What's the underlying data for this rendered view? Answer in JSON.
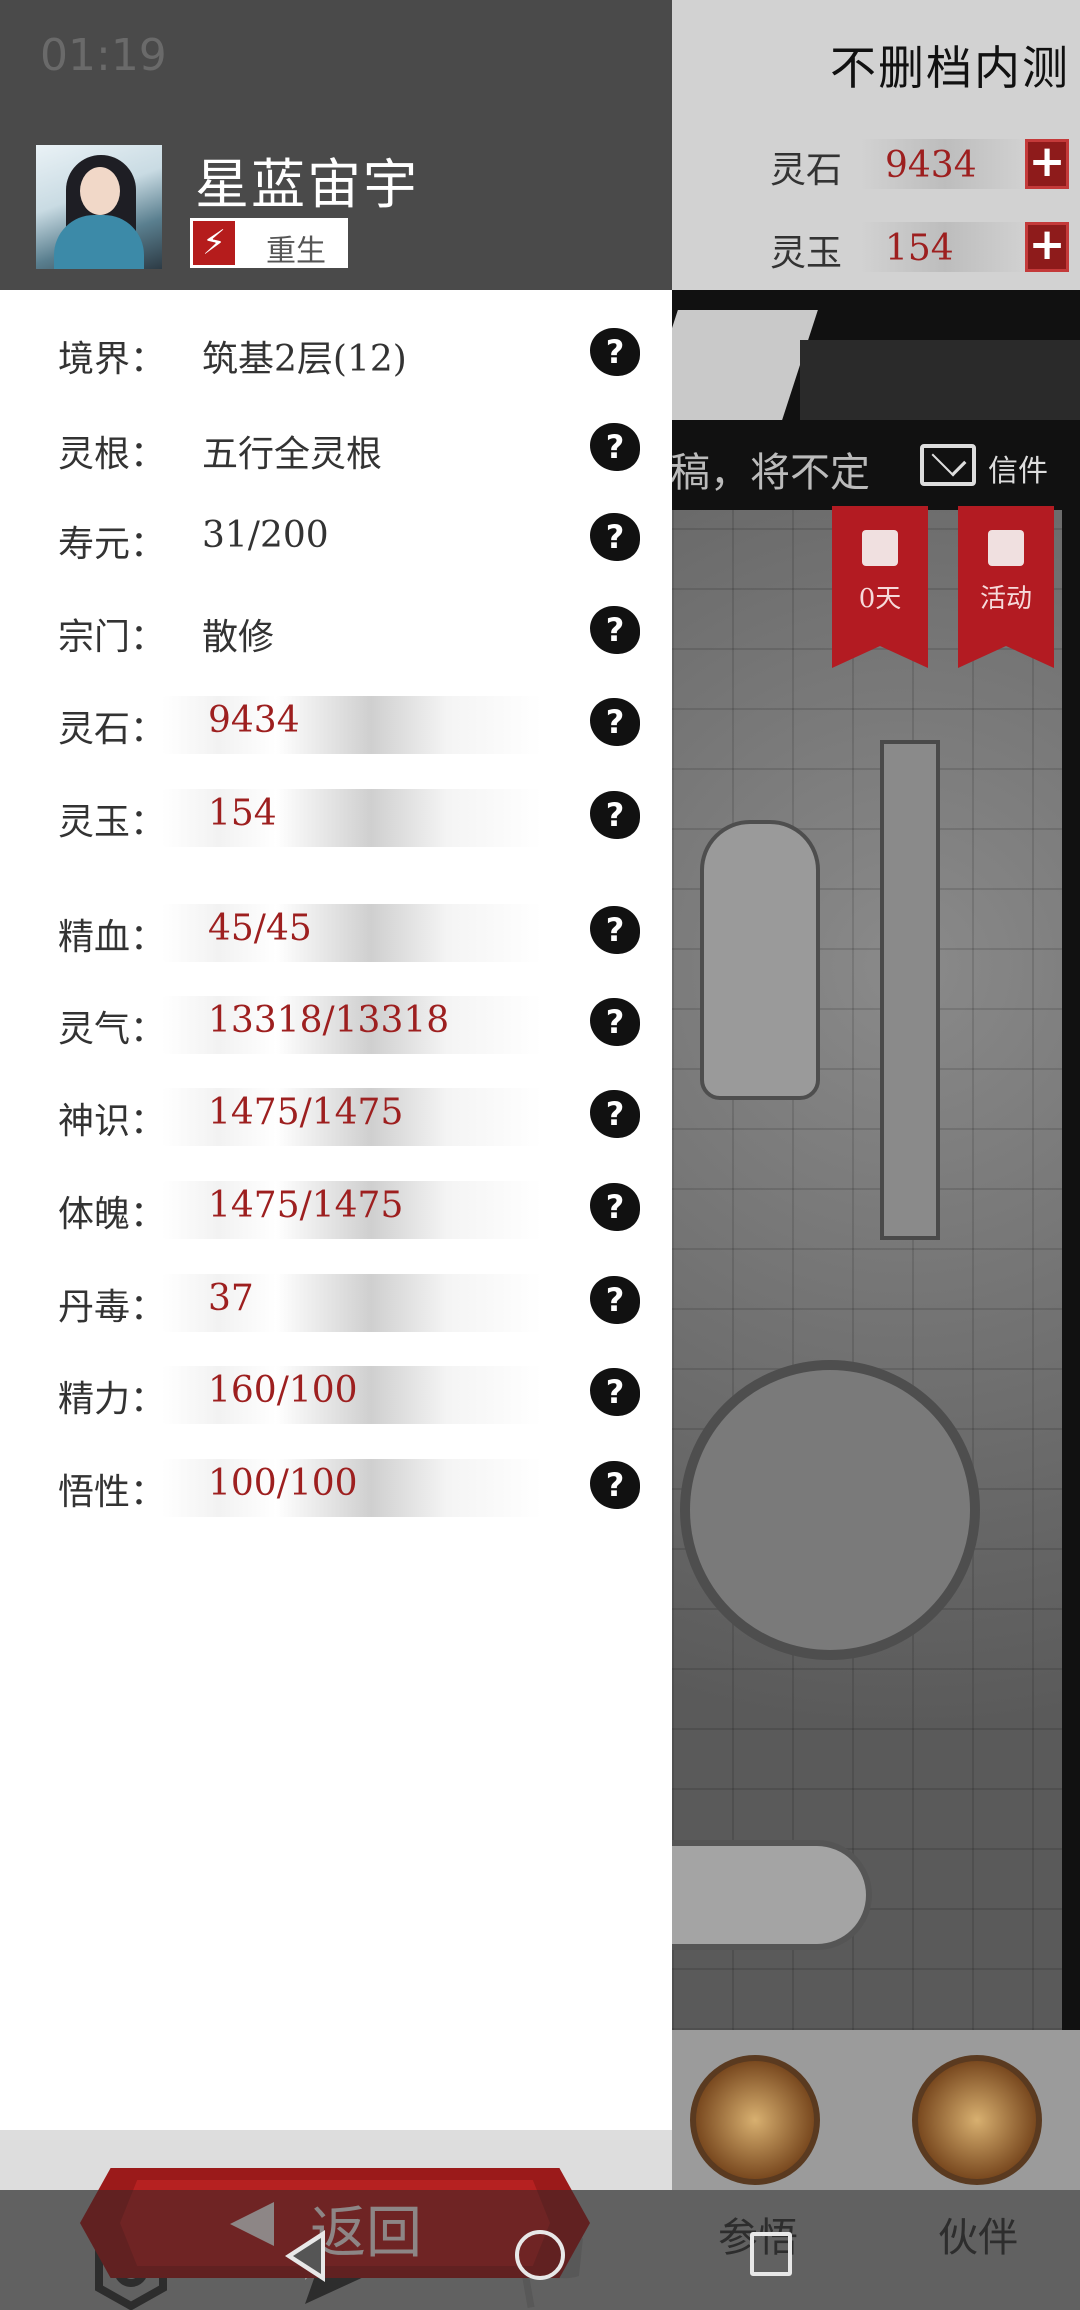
{
  "status_bar": {
    "time": "01:19"
  },
  "game": {
    "title": "不删档内测",
    "resources": [
      {
        "name": "灵石",
        "value": "9434"
      },
      {
        "name": "灵玉",
        "value": "154"
      }
    ],
    "notice_text": "稿，将不定",
    "mail_label": "信件",
    "banners": [
      {
        "label": "0天",
        "icon": "order-icon"
      },
      {
        "label": "活动",
        "icon": "flag-icon"
      }
    ],
    "bottom_tabs": [
      {
        "label": "参悟",
        "icon": "scroll-icon"
      },
      {
        "label": "伙伴",
        "icon": "partner-icon"
      }
    ]
  },
  "profile": {
    "name": "星蓝宙宇",
    "badge": "重生",
    "badge_icon": "lightning-icon"
  },
  "stats": [
    {
      "label": "境界：",
      "value": "筑基2层(12)",
      "bar": false
    },
    {
      "label": "灵根：",
      "value": "五行全灵根",
      "bar": false
    },
    {
      "label": "寿元：",
      "value": "31/200",
      "bar": false
    },
    {
      "label": "宗门：",
      "value": "散修",
      "bar": false
    },
    {
      "label": "灵石：",
      "value": "9434",
      "bar": true
    },
    {
      "label": "灵玉：",
      "value": "154",
      "bar": true
    },
    {
      "label": "精血：",
      "value": "45/45",
      "bar": true
    },
    {
      "label": "灵气：",
      "value": "13318/13318",
      "bar": true
    },
    {
      "label": "神识：",
      "value": "1475/1475",
      "bar": true
    },
    {
      "label": "体魄：",
      "value": "1475/1475",
      "bar": true
    },
    {
      "label": "丹毒：",
      "value": "37",
      "bar": true
    },
    {
      "label": "精力：",
      "value": "160/100",
      "bar": true
    },
    {
      "label": "悟性：",
      "value": "100/100",
      "bar": true
    }
  ],
  "help_glyph": "?",
  "actions": [
    {
      "label": "设置",
      "icon": "settings-icon"
    },
    {
      "label": "传信",
      "icon": "send-icon"
    },
    {
      "label": "活动",
      "icon": "flag-icon"
    }
  ],
  "return_button": {
    "label": "返回"
  },
  "colors": {
    "accent_red": "#9d1f1f",
    "button_red": "#b62121"
  }
}
